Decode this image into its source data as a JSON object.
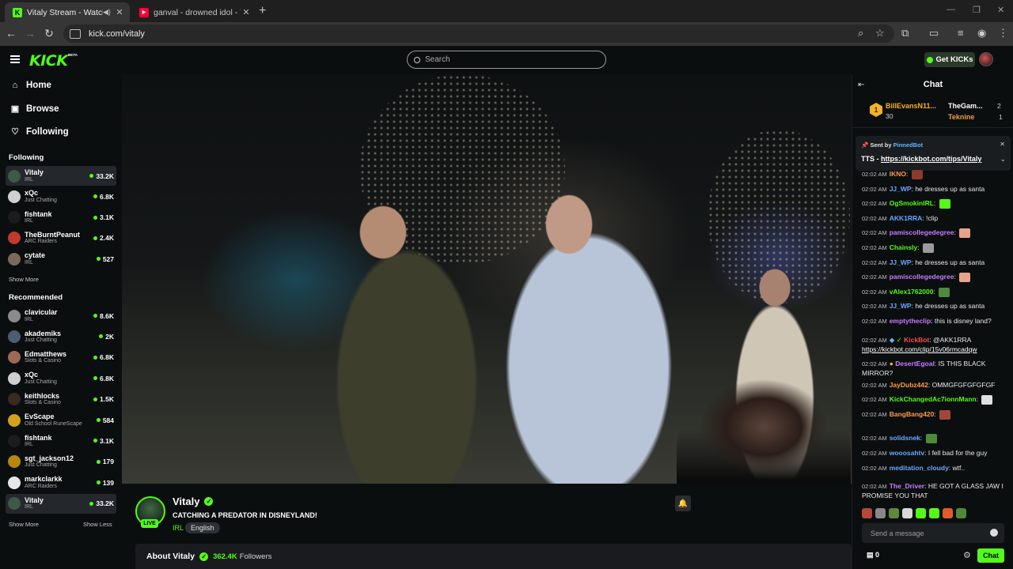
{
  "browser": {
    "tabs": [
      {
        "title": "Vitaly Stream - Watch Live on",
        "favicon": "kick-favicon",
        "active": true
      },
      {
        "title": "ganval - drowned idol - YouTube",
        "favicon": "youtube-favicon",
        "active": false
      }
    ],
    "url": "kick.com/vitaly"
  },
  "header": {
    "logo": "KICK",
    "logo_badge": "BETA",
    "search_placeholder": "Search",
    "get_kicks": "Get KICKs"
  },
  "sidebar": {
    "nav": [
      {
        "label": "Home",
        "icon": "home-icon"
      },
      {
        "label": "Browse",
        "icon": "browse-icon"
      },
      {
        "label": "Following",
        "icon": "heart-icon"
      }
    ],
    "following_title": "Following",
    "following": [
      {
        "name": "Vitaly",
        "category": "IRL",
        "viewers": "33.2K",
        "color": "#3d5a44"
      },
      {
        "name": "xQc",
        "category": "Just Chatting",
        "viewers": "6.8K",
        "color": "#cfcfcf"
      },
      {
        "name": "fishtank",
        "category": "IRL",
        "viewers": "3.1K",
        "color": "#1c1c1c"
      },
      {
        "name": "TheBurntPeanut",
        "category": "ARC Raiders",
        "viewers": "2.4K",
        "color": "#c0392b"
      },
      {
        "name": "cytate",
        "category": "IRL",
        "viewers": "527",
        "color": "#7a6a5a"
      }
    ],
    "show_more_1": "Show More",
    "recommended_title": "Recommended",
    "recommended": [
      {
        "name": "clavicular",
        "category": "IRL",
        "viewers": "8.6K",
        "color": "#8a8a8a"
      },
      {
        "name": "akademiks",
        "category": "Just Chatting",
        "viewers": "2K",
        "color": "#4b5d73"
      },
      {
        "name": "Edmatthews",
        "category": "Slots & Casino",
        "viewers": "6.8K",
        "color": "#9b6a52"
      },
      {
        "name": "xQc",
        "category": "Just Chatting",
        "viewers": "6.8K",
        "color": "#cfcfcf"
      },
      {
        "name": "keithlocks",
        "category": "Slots & Casino",
        "viewers": "1.5K",
        "color": "#3a2a22"
      },
      {
        "name": "EvScape",
        "category": "Old School RuneScape",
        "viewers": "584",
        "color": "#d4a017"
      },
      {
        "name": "fishtank",
        "category": "IRL",
        "viewers": "3.1K",
        "color": "#1c1c1c"
      },
      {
        "name": "sgt_jackson12",
        "category": "Just Chatting",
        "viewers": "179",
        "color": "#b8860b"
      },
      {
        "name": "markclarkk",
        "category": "ARC Raiders",
        "viewers": "139",
        "color": "#e6e6e6"
      },
      {
        "name": "Vitaly",
        "category": "IRL",
        "viewers": "33.2K",
        "color": "#3d5a44"
      }
    ],
    "show_more_2": "Show More",
    "show_less": "Show Less"
  },
  "stream": {
    "name": "Vitaly",
    "title": "CATCHING A PREDATOR IN DISNEYLAND!",
    "category": "IRL",
    "language": "English",
    "live_badge": "LIVE",
    "about_title": "About Vitaly",
    "followers": "362.4K",
    "followers_label": "Followers"
  },
  "chat": {
    "title": "Chat",
    "leaderboard": [
      {
        "name": "BillEvansN11...",
        "count": "30"
      },
      {
        "name": "TheGam...",
        "count": "2"
      },
      {
        "name": "Teknine",
        "count": "1"
      }
    ],
    "pinned": {
      "sent_by": "Sent by",
      "bot": "PinnedBot",
      "prefix": "TTS - ",
      "link": "https://kickbot.com/tips/Vitaly"
    },
    "messages": [
      {
        "time": "02:02 AM",
        "user": "IKNO",
        "text": "",
        "color": "#ff9a4a",
        "emote": "#8a3b2b"
      },
      {
        "time": "02:02 AM",
        "user": "JJ_WP",
        "text": "he dresses up as santa",
        "color": "#6aa7ff",
        "emote": ""
      },
      {
        "time": "02:02 AM",
        "user": "OgSmokinIRL",
        "text": "",
        "color": "#53fc18",
        "emote": "#53fc18"
      },
      {
        "time": "02:02 AM",
        "user": "AKK1RRA",
        "text": "!clip",
        "color": "#6aa7ff",
        "emote": ""
      },
      {
        "time": "02:02 AM",
        "user": "pamiscollegedegree",
        "text": "",
        "color": "#c77dff",
        "emote": "#e8a38a"
      },
      {
        "time": "02:02 AM",
        "user": "Chainsly",
        "text": "",
        "color": "#53fc18",
        "emote": "#9a9a9a"
      },
      {
        "time": "02:02 AM",
        "user": "JJ_WP",
        "text": "he dresses up as santa",
        "color": "#6aa7ff",
        "emote": ""
      },
      {
        "time": "02:02 AM",
        "user": "pamiscollegedegree",
        "text": "",
        "color": "#c77dff",
        "emote": "#e8a38a"
      },
      {
        "time": "02:02 AM",
        "user": "vAlex1762000",
        "text": "",
        "color": "#53fc18",
        "emote": "#4d8a3a"
      },
      {
        "time": "02:02 AM",
        "user": "JJ_WP",
        "text": "he dresses up as santa",
        "color": "#6aa7ff",
        "emote": ""
      },
      {
        "time": "02:02 AM",
        "user": "emptytheclip",
        "text": "this is disney land?",
        "color": "#c77dff",
        "emote": ""
      }
    ],
    "kickbot": {
      "time": "02:02 AM",
      "user": "KickBot",
      "text": "@AKK1RRA",
      "link": "https://kickbot.com/clip/15v06rmcadqw"
    },
    "desert": {
      "time": "02:02 AM",
      "user": "DesertEgoal",
      "text": "IS THIS BLACK",
      "text2": "MIRROR?"
    },
    "messages2": [
      {
        "time": "02:02 AM",
        "user": "JayDubz442",
        "text": "OMMGFGFGFGFGF",
        "color": "#ff9a4a",
        "emote": ""
      },
      {
        "time": "02:02 AM",
        "user": "KickChangedAc7ionnMann",
        "text": "",
        "color": "#53fc18",
        "emote": "#e0e0e0"
      },
      {
        "time": "02:02 AM",
        "user": "BangBang420",
        "text": "",
        "color": "#ff9a4a",
        "emote": "#a0473a"
      },
      {
        "time": "02:02 AM",
        "user": "solidsnek",
        "text": "",
        "color": "#6aa7ff",
        "emote": "#4d8a3a"
      },
      {
        "time": "02:02 AM",
        "user": "wooosahtv",
        "text": "I fell bad for the guy",
        "color": "#6aa7ff",
        "emote": ""
      },
      {
        "time": "02:02 AM",
        "user": "meditation_cloudy",
        "text": "wtf..",
        "color": "#6aa7ff",
        "emote": ""
      }
    ],
    "driver": {
      "time": "02:02 AM",
      "user": "The_Driver",
      "text": "HE GOT A GLASS JAW I",
      "text2": "PROMISE YOU THAT"
    },
    "send_placeholder": "Send a message",
    "kicks_count": "0",
    "send_button": "Chat"
  }
}
